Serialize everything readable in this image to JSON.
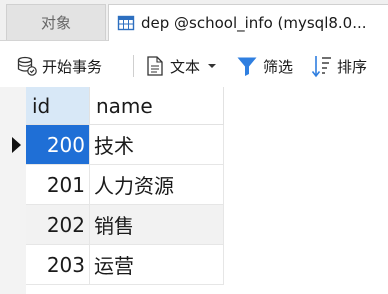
{
  "tabs": {
    "objects_label": "对象",
    "active_label": "dep @school_info (mysql8.0..."
  },
  "toolbar": {
    "begin_transaction": "开始事务",
    "text": "文本",
    "filter": "筛选",
    "sort": "排序"
  },
  "table": {
    "columns": [
      "id",
      "name"
    ],
    "rows": [
      {
        "id": "200",
        "name": "技术"
      },
      {
        "id": "201",
        "name": "人力资源"
      },
      {
        "id": "202",
        "name": "销售"
      },
      {
        "id": "203",
        "name": "运营"
      }
    ],
    "selected_row": 0
  },
  "colors": {
    "selection": "#1f6fd6",
    "header_highlight": "#d8e8f7",
    "filter_icon": "#2f7fe0"
  }
}
